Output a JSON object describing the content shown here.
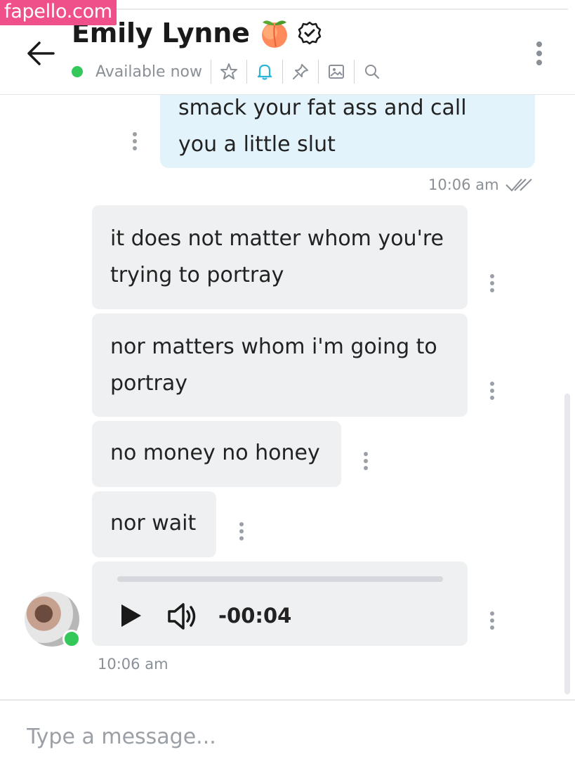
{
  "watermark": "fapello.com",
  "header": {
    "name": "Emily Lynne",
    "status": "Available now",
    "colors": {
      "online": "#34c759",
      "bell_active": "#2ab4d6"
    },
    "icons": [
      "star-icon",
      "bell-icon",
      "pin-icon",
      "image-icon",
      "search-icon"
    ]
  },
  "messages": {
    "outgoing": {
      "partial_line": "smack your fat ass and call",
      "line": "you a little slut",
      "time": "10:06 am"
    },
    "incoming": [
      {
        "line1": "it does not matter whom you're",
        "line2": "trying to portray"
      },
      {
        "line1": "nor matters whom i'm going to",
        "line2": "portray"
      },
      {
        "line1": "no money no honey"
      },
      {
        "line1": "nor wait"
      }
    ],
    "audio": {
      "time": "-00:04"
    },
    "incoming_time": "10:06 am"
  },
  "composer": {
    "placeholder": "Type a message..."
  }
}
